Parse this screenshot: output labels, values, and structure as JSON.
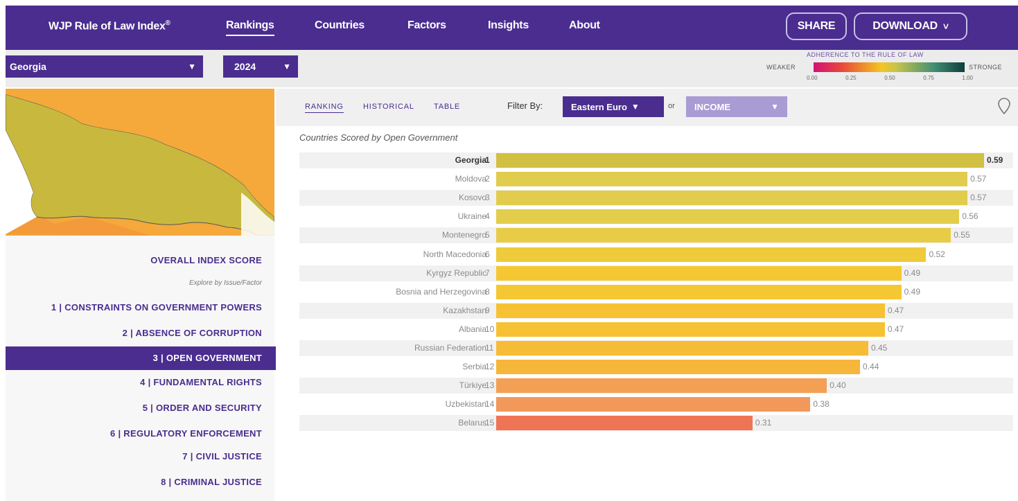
{
  "header": {
    "brand": "WJP Rule of Law Index",
    "brand_mark": "®",
    "nav": [
      {
        "label": "Rankings",
        "active": true
      },
      {
        "label": "Countries",
        "active": false
      },
      {
        "label": "Factors",
        "active": false
      },
      {
        "label": "Insights",
        "active": false
      },
      {
        "label": "About",
        "active": false
      }
    ],
    "share_label": "SHARE",
    "download_label": "DOWNLOAD",
    "download_chevron": "˅"
  },
  "selectors": {
    "country": "Georgia",
    "year": "2024",
    "arrow": "▼"
  },
  "legend": {
    "title": "ADHERENCE TO THE RULE OF LAW",
    "weaker": "WEAKER",
    "stronger": "STRONGE",
    "ticks": [
      "0.00",
      "0.25",
      "0.50",
      "0.75",
      "1.00"
    ],
    "gradient_colors": [
      "#d3117a",
      "#e8453c",
      "#f3c623",
      "#c5c34e",
      "#3f8e73",
      "#0f3d3d"
    ]
  },
  "left_menu": {
    "overall": "OVERALL INDEX SCORE",
    "explore": "Explore by Issue/Factor",
    "factors": [
      "1 | CONSTRAINTS ON GOVERNMENT POWERS",
      "2 | ABSENCE OF CORRUPTION",
      "3 | OPEN GOVERNMENT",
      "4 | FUNDAMENTAL RIGHTS",
      "5 | ORDER AND SECURITY",
      "6 | REGULATORY ENFORCEMENT",
      "7 | CIVIL JUSTICE",
      "8 | CRIMINAL JUSTICE"
    ],
    "active_index": 2
  },
  "map": {
    "country_color": "#c8b93e",
    "neighbor_color": "#f4a93a",
    "neighbor2_color": "#f39a3a"
  },
  "tabs": [
    {
      "label": "RANKING",
      "active": true
    },
    {
      "label": "HISTORICAL",
      "active": false
    },
    {
      "label": "TABLE",
      "active": false
    }
  ],
  "filter": {
    "label": "Filter By:",
    "region": "Eastern Euro",
    "or": "or",
    "income": "INCOME",
    "arrow": "▼",
    "region_color": "#4a2d8f",
    "income_color": "#a99bd3"
  },
  "chart_data": {
    "type": "bar",
    "title": "Countries Scored by Open Government",
    "orientation": "horizontal",
    "xlim": [
      0,
      0.59
    ],
    "highlight": "Georgia",
    "categories": [
      "Georgia",
      "Moldova",
      "Kosovo",
      "Ukraine",
      "Montenegro",
      "North Macedonia",
      "Kyrgyz Republic",
      "Bosnia and Herzegovina",
      "Kazakhstan",
      "Albania",
      "Russian Federation",
      "Serbia",
      "Türkiye",
      "Uzbekistan",
      "Belarus"
    ],
    "ranks": [
      1,
      2,
      3,
      4,
      5,
      6,
      7,
      8,
      9,
      10,
      11,
      12,
      13,
      14,
      15
    ],
    "values": [
      0.59,
      0.57,
      0.57,
      0.56,
      0.55,
      0.52,
      0.49,
      0.49,
      0.47,
      0.47,
      0.45,
      0.44,
      0.4,
      0.38,
      0.31
    ],
    "value_labels": [
      "0.59",
      "0.57",
      "0.57",
      "0.56",
      "0.55",
      "0.52",
      "0.49",
      "0.49",
      "0.47",
      "0.47",
      "0.45",
      "0.44",
      "0.40",
      "0.38",
      "0.31"
    ],
    "colors": [
      "#d2c042",
      "#e1cc4d",
      "#e1cc4d",
      "#e3cd4d",
      "#e8cc48",
      "#efca3a",
      "#f5c733",
      "#f5c733",
      "#f6c233",
      "#f6c233",
      "#f6bc35",
      "#f6b63a",
      "#f3a055",
      "#f2985a",
      "#ef7456"
    ]
  }
}
